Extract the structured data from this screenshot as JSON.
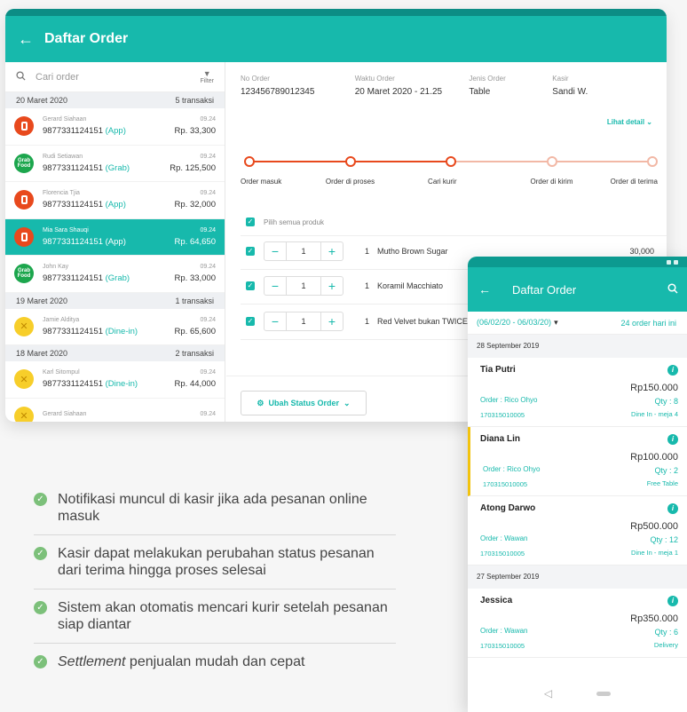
{
  "tablet": {
    "title": "Daftar Order",
    "search_placeholder": "Cari order",
    "filter_label": "Filter",
    "groups": [
      {
        "date": "20 Maret 2020",
        "count": "5 transaksi",
        "orders": [
          {
            "name": "Gerard Siahaan",
            "number": "9877331124151",
            "source": "(App)",
            "type": "app",
            "time": "09.24",
            "amount": "Rp. 33,300",
            "active": false
          },
          {
            "name": "Rudi Setiawan",
            "number": "9877331124151",
            "source": "(Grab)",
            "type": "grab",
            "time": "09.24",
            "amount": "Rp. 125,500",
            "active": false
          },
          {
            "name": "Florencia Tjia",
            "number": "9877331124151",
            "source": "(App)",
            "type": "app",
            "time": "09.24",
            "amount": "Rp. 32,000",
            "active": false
          },
          {
            "name": "Mia Sara Shauqi",
            "number": "9877331124151",
            "source": "(App)",
            "type": "app",
            "time": "09.24",
            "amount": "Rp. 64,650",
            "active": true
          },
          {
            "name": "John Kay",
            "number": "9877331124151",
            "source": "(Grab)",
            "type": "grab",
            "time": "09.24",
            "amount": "Rp. 33,000",
            "active": false
          }
        ]
      },
      {
        "date": "19 Maret 2020",
        "count": "1 transaksi",
        "orders": [
          {
            "name": "Jamie Alditya",
            "number": "9877331124151",
            "source": "(Dine-in)",
            "type": "dine",
            "time": "09.24",
            "amount": "Rp. 65,600",
            "active": false
          }
        ]
      },
      {
        "date": "18 Maret 2020",
        "count": "2 transaksi",
        "orders": [
          {
            "name": "Karl Sitompul",
            "number": "9877331124151",
            "source": "(Dine-in)",
            "type": "dine",
            "time": "09.24",
            "amount": "Rp. 44,000",
            "active": false
          },
          {
            "name": "Gerard Siahaan",
            "number": "",
            "source": "",
            "type": "dine",
            "time": "09.24",
            "amount": "",
            "active": false
          }
        ]
      }
    ],
    "grab_logo": "Grab Food",
    "info": [
      {
        "label": "No Order",
        "value": "123456789012345"
      },
      {
        "label": "Waktu Order",
        "value": "20 Maret 2020 - 21.25"
      },
      {
        "label": "Jenis Order",
        "value": "Table"
      },
      {
        "label": "Kasir",
        "value": "Sandi W."
      }
    ],
    "detail_link": "Lihat detail ⌄",
    "steps": [
      {
        "label": "Order masuk",
        "done": true
      },
      {
        "label": "Order di proses",
        "done": true
      },
      {
        "label": "Cari kurir",
        "done": true
      },
      {
        "label": "Order di kirim",
        "done": false
      },
      {
        "label": "Order di terima",
        "done": false
      }
    ],
    "select_all": "Pilih semua produk",
    "products": [
      {
        "stepper_value": "1",
        "qty": "1",
        "name": "Mutho Brown Sugar",
        "price": "30,000"
      },
      {
        "stepper_value": "1",
        "qty": "1",
        "name": "Koramil Macchiato",
        "price": ""
      },
      {
        "stepper_value": "1",
        "qty": "1",
        "name": "Red Velvet bukan TWICE",
        "price": ""
      }
    ],
    "status_button": "Ubah Status Order"
  },
  "features": [
    {
      "text": "Notifikasi muncul di kasir jika ada pesanan online masuk",
      "em": ""
    },
    {
      "text": "Kasir dapat melakukan perubahan status pesanan dari terima hingga proses selesai",
      "em": ""
    },
    {
      "text": "Sistem akan otomatis mencari kurir setelah pesanan siap diantar",
      "em": ""
    },
    {
      "text": " penjualan mudah dan cepat",
      "em": "Settlement"
    }
  ],
  "phone": {
    "title": "Daftar Order",
    "range": "(06/02/20 - 06/03/20)",
    "count": "24 order hari ini",
    "groups": [
      {
        "date": "28 September 2019",
        "orders": [
          {
            "name": "Tia Putri",
            "price": "Rp150.000",
            "cashier": "Order : Rico Ohyo",
            "qty": "Qty : 8",
            "id": "170315010005",
            "type": "Dine In - meja 4",
            "highlight": false
          },
          {
            "name": "Diana Lin",
            "price": "Rp100.000",
            "cashier": "Order : Rico Ohyo",
            "qty": "Qty : 2",
            "id": "170315010005",
            "type": "Free Table",
            "highlight": true
          },
          {
            "name": "Atong Darwo",
            "price": "Rp500.000",
            "cashier": "Order : Wawan",
            "qty": "Qty : 12",
            "id": "170315010005",
            "type": "Dine In - meja 1",
            "highlight": false
          }
        ]
      },
      {
        "date": "27 September 2019",
        "orders": [
          {
            "name": "Jessica",
            "price": "Rp350.000",
            "cashier": "Order : Wawan",
            "qty": "Qty : 6",
            "id": "170315010005",
            "type": "Delivery",
            "highlight": false
          }
        ]
      }
    ]
  },
  "colors": {
    "accent": "#17b9ac",
    "progress": "#e8491d",
    "progress_pending": "#f2b8a6",
    "check": "#7cc07a",
    "highlight": "#f2c30f"
  }
}
